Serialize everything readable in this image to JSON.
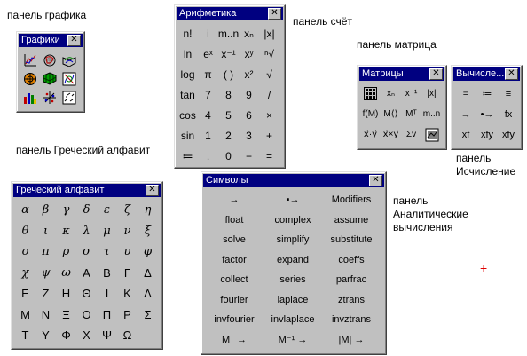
{
  "captions": {
    "graph": "панель графика",
    "arith": "панель счёт",
    "matrix": "панель матрица",
    "greek": "панель Греческий алфавит",
    "calculus": "панель\nИсчисление",
    "symbolic": "панель\nАналитические\nвычисления"
  },
  "graph_palette": {
    "title": "Графики",
    "close": "✕",
    "icons": [
      "xy-plot-icon",
      "polar-plot-icon",
      "surface-plot-icon",
      "contour-plot-icon",
      "3d-bar-icon",
      "scatter-3d-icon",
      "vector-field-icon",
      "zoom-icon",
      "trace-icon"
    ]
  },
  "arith_palette": {
    "title": "Арифметика",
    "close": "✕",
    "keys": [
      "n!",
      "i",
      "m..n",
      "xₙ",
      "|x|",
      "ln",
      "eˣ",
      "x⁻¹",
      "xʸ",
      "ⁿ√",
      "log",
      "π",
      "( )",
      "x²",
      "√",
      "tan",
      "7",
      "8",
      "9",
      "/",
      "cos",
      "4",
      "5",
      "6",
      "×",
      "sin",
      "1",
      "2",
      "3",
      "+",
      "≔",
      ".",
      "0",
      "−",
      "="
    ]
  },
  "matrix_palette": {
    "title": "Матрицы",
    "close": "✕",
    "keys": [
      "matrix-grid",
      "xₙ",
      "x⁻¹",
      "|x|",
      "f(M)",
      "M⟨⟩",
      "Mᵀ",
      "m..n",
      "x⃗·y⃗",
      "x⃗×y⃗",
      "Σv",
      "picture"
    ]
  },
  "calc_palette": {
    "title": "Вычисле...",
    "close": "✕",
    "keys": [
      "=",
      "≔",
      "≡",
      "→",
      "•→",
      "fx",
      "xf",
      "xfy",
      "xfy"
    ]
  },
  "greek_palette": {
    "title": "Греческий алфавит",
    "close": "✕",
    "lower": [
      "α",
      "β",
      "γ",
      "δ",
      "ε",
      "ζ",
      "η",
      "θ",
      "ι",
      "κ",
      "λ",
      "μ",
      "ν",
      "ξ",
      "ο",
      "π",
      "ρ",
      "σ",
      "τ",
      "υ",
      "φ",
      "χ",
      "ψ",
      "ω"
    ],
    "upper": [
      "Α",
      "Β",
      "Γ",
      "Δ",
      "Ε",
      "Ζ",
      "Η",
      "Θ",
      "Ι",
      "Κ",
      "Λ",
      "Μ",
      "Ν",
      "Ξ",
      "Ο",
      "Π",
      "Ρ",
      "Σ",
      "Τ",
      "Υ",
      "Φ",
      "Χ",
      "Ψ",
      "Ω"
    ]
  },
  "symbols_palette": {
    "title": "Символы",
    "close": "✕",
    "keys": [
      "→",
      "▪→",
      "Modifiers",
      "float",
      "complex",
      "assume",
      "solve",
      "simplify",
      "substitute",
      "factor",
      "expand",
      "coeffs",
      "collect",
      "series",
      "parfrac",
      "fourier",
      "laplace",
      "ztrans",
      "invfourier",
      "invlaplace",
      "invztrans",
      "Mᵀ →",
      "M⁻¹ →",
      "|M| →"
    ]
  },
  "cursor_mark": "+",
  "colors": {
    "titlebar": "#000080",
    "face": "#c0c0c0",
    "cursor": "#e00000"
  }
}
